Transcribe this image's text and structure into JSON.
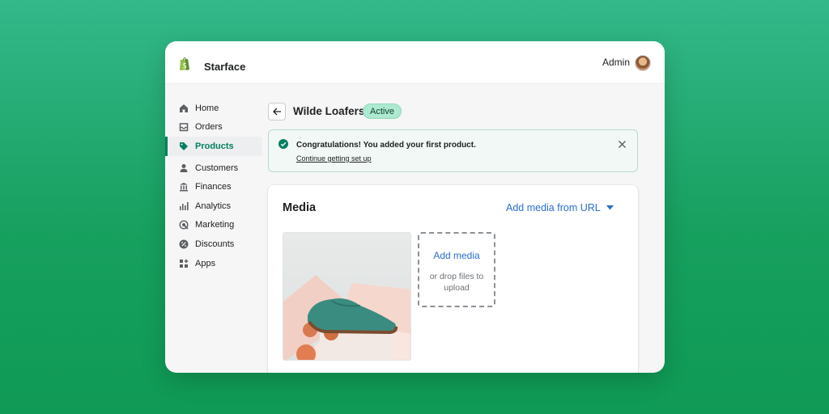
{
  "header": {
    "store_name": "Starface",
    "user_label": "Admin"
  },
  "sidebar": {
    "items": [
      {
        "label": "Home",
        "icon": "home-icon"
      },
      {
        "label": "Orders",
        "icon": "inbox-icon"
      },
      {
        "label": "Products",
        "icon": "tag-icon",
        "active": true
      },
      {
        "label": "Customers",
        "icon": "person-icon"
      },
      {
        "label": "Finances",
        "icon": "bank-icon"
      },
      {
        "label": "Analytics",
        "icon": "bar-chart-icon"
      },
      {
        "label": "Marketing",
        "icon": "target-icon"
      },
      {
        "label": "Discounts",
        "icon": "percent-icon"
      },
      {
        "label": "Apps",
        "icon": "apps-grid-icon"
      }
    ]
  },
  "product": {
    "title": "Wilde Loafers",
    "status": "Active"
  },
  "banner": {
    "message": "Congratulations! You added your first product.",
    "link": "Continue getting set up"
  },
  "media": {
    "title": "Media",
    "add_from_url": "Add media from URL",
    "dropzone_action": "Add media",
    "dropzone_hint": "or drop files to upload"
  },
  "colors": {
    "brand_green": "#008060",
    "link_blue": "#2c6ecb",
    "badge_bg": "#aee9d1",
    "background_green": "#17a05f"
  }
}
